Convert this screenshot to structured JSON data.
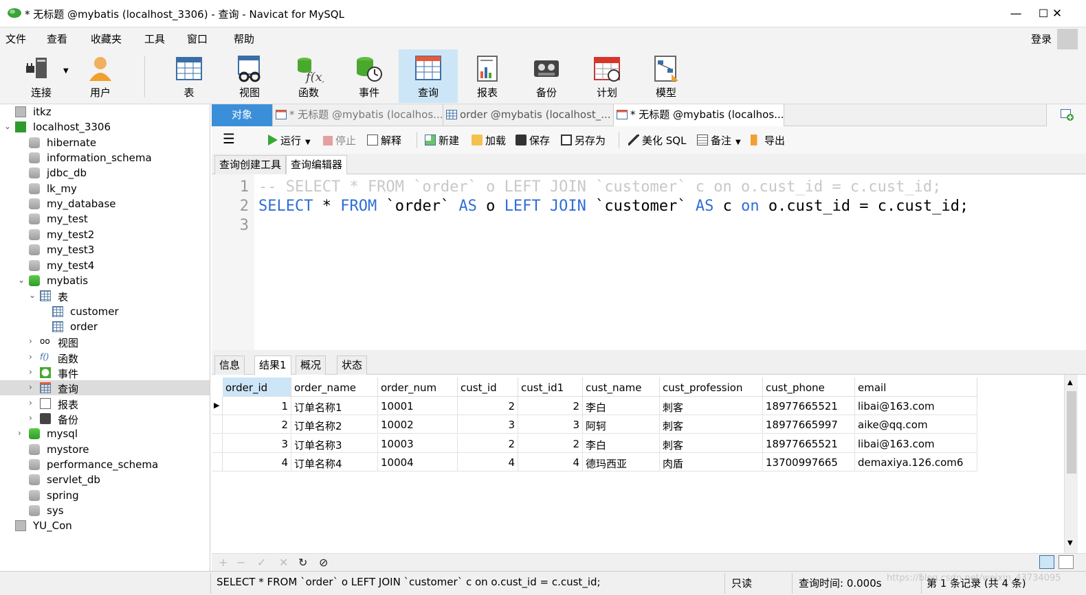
{
  "window": {
    "title": "* 无标题 @mybatis (localhost_3306) - 查询 - Navicat for MySQL",
    "minimize": "—",
    "maximize": "☐",
    "close": "✕"
  },
  "menu": [
    "文件",
    "查看",
    "收藏夹",
    "工具",
    "窗口",
    "帮助"
  ],
  "login": "登录",
  "toolbar": [
    {
      "label": "连接",
      "icon": "plug-server-icon"
    },
    {
      "label": "用户",
      "icon": "user-icon"
    },
    {
      "label": "表",
      "icon": "table-icon"
    },
    {
      "label": "视图",
      "icon": "view-glasses-icon"
    },
    {
      "label": "函数",
      "icon": "function-icon"
    },
    {
      "label": "事件",
      "icon": "event-clock-icon"
    },
    {
      "label": "查询",
      "icon": "query-icon"
    },
    {
      "label": "报表",
      "icon": "report-icon"
    },
    {
      "label": "备份",
      "icon": "backup-tape-icon"
    },
    {
      "label": "计划",
      "icon": "calendar-icon"
    },
    {
      "label": "模型",
      "icon": "model-icon"
    }
  ],
  "tree": [
    {
      "label": "itkz",
      "level": 0,
      "type": "conn"
    },
    {
      "label": "localhost_3306",
      "level": 0,
      "type": "conn-open",
      "expanded": true
    },
    {
      "label": "hibernate",
      "level": 1,
      "type": "db"
    },
    {
      "label": "information_schema",
      "level": 1,
      "type": "db"
    },
    {
      "label": "jdbc_db",
      "level": 1,
      "type": "db"
    },
    {
      "label": "lk_my",
      "level": 1,
      "type": "db"
    },
    {
      "label": "my_database",
      "level": 1,
      "type": "db"
    },
    {
      "label": "my_test",
      "level": 1,
      "type": "db"
    },
    {
      "label": "my_test2",
      "level": 1,
      "type": "db"
    },
    {
      "label": "my_test3",
      "level": 1,
      "type": "db"
    },
    {
      "label": "my_test4",
      "level": 1,
      "type": "db"
    },
    {
      "label": "mybatis",
      "level": 1,
      "type": "db-open",
      "expanded": true
    },
    {
      "label": "表",
      "level": 2,
      "type": "tables",
      "expanded": true
    },
    {
      "label": "customer",
      "level": 3,
      "type": "table"
    },
    {
      "label": "order",
      "level": 3,
      "type": "table"
    },
    {
      "label": "视图",
      "level": 2,
      "type": "views"
    },
    {
      "label": "函数",
      "level": 2,
      "type": "funcs"
    },
    {
      "label": "事件",
      "level": 2,
      "type": "events"
    },
    {
      "label": "查询",
      "level": 2,
      "type": "queries",
      "selected": true
    },
    {
      "label": "报表",
      "level": 2,
      "type": "reports"
    },
    {
      "label": "备份",
      "level": 2,
      "type": "backups"
    },
    {
      "label": "mysql",
      "level": 1,
      "type": "db-open-collapsed"
    },
    {
      "label": "mystore",
      "level": 1,
      "type": "db"
    },
    {
      "label": "performance_schema",
      "level": 1,
      "type": "db"
    },
    {
      "label": "servlet_db",
      "level": 1,
      "type": "db"
    },
    {
      "label": "spring",
      "level": 1,
      "type": "db"
    },
    {
      "label": "sys",
      "level": 1,
      "type": "db"
    },
    {
      "label": "YU_Con",
      "level": 0,
      "type": "conn"
    }
  ],
  "doc_tabs": {
    "objects": "对象",
    "tab1": "* 无标题 @mybatis (localhos...",
    "tab2": "order @mybatis (localhost_...",
    "tab3": "* 无标题 @mybatis (localhos..."
  },
  "query_toolbar": {
    "run": "运行",
    "stop": "停止",
    "explain": "解释",
    "new": "新建",
    "load": "加载",
    "save": "保存",
    "save_as": "另存为",
    "beautify": "美化 SQL",
    "comment": "备注",
    "export": "导出"
  },
  "editor_tabs": {
    "builder": "查询创建工具",
    "editor": "查询编辑器"
  },
  "editor": {
    "line_numbers": [
      "1",
      "2",
      "3"
    ]
  },
  "result_tabs": {
    "info": "信息",
    "result1": "结果1",
    "overview": "概况",
    "status": "状态"
  },
  "grid": {
    "columns": [
      "order_id",
      "order_name",
      "order_num",
      "cust_id",
      "cust_id1",
      "cust_name",
      "cust_profession",
      "cust_phone",
      "email"
    ],
    "rows": [
      [
        "1",
        "订单名称1",
        "10001",
        "2",
        "2",
        "李白",
        "刺客",
        "18977665521",
        "libai@163.com"
      ],
      [
        "2",
        "订单名称2",
        "10002",
        "3",
        "3",
        "阿轲",
        "刺客",
        "18977665997",
        "aike@qq.com"
      ],
      [
        "3",
        "订单名称3",
        "10003",
        "2",
        "2",
        "李白",
        "刺客",
        "18977665521",
        "libai@163.com"
      ],
      [
        "4",
        "订单名称4",
        "10004",
        "4",
        "4",
        "德玛西亚",
        "肉盾",
        "13700997665",
        "demaxiya.126.com6"
      ]
    ]
  },
  "status": {
    "sql": "SELECT * FROM `order` o LEFT JOIN `customer` c on o.cust_id = c.cust_id;",
    "readonly": "只读",
    "time": "查询时间: 0.000s",
    "record": "第 1 条记录 (共 4 条)"
  },
  "watermark": "https://blog.csdn.net/weixin_43734095",
  "colors": {
    "accent": "#3b8fd9",
    "keyword": "#2f6dd6",
    "comment": "#c8c8c8",
    "selected": "#cde6f7"
  }
}
